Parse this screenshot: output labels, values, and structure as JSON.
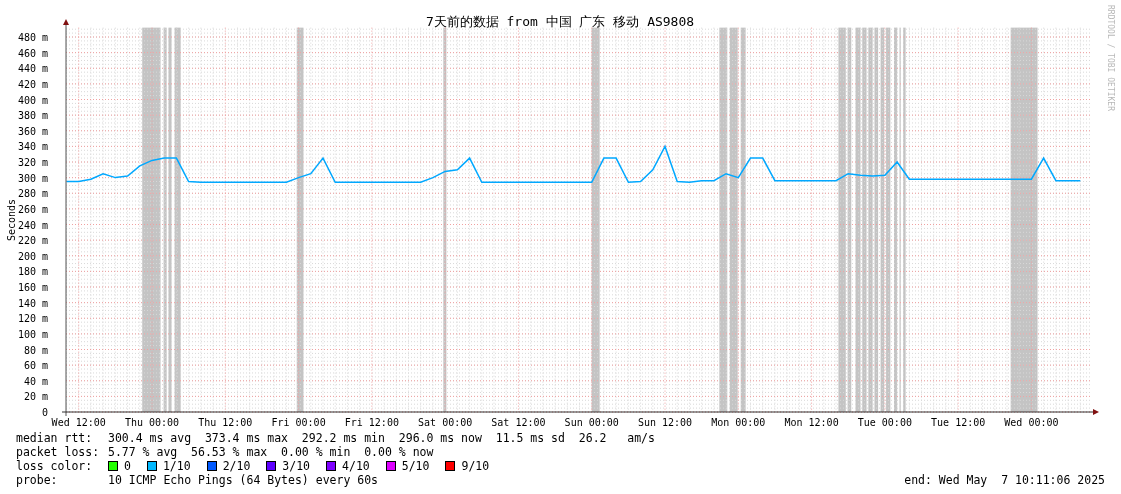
{
  "chart": {
    "credit": "RRDTOOL / TOBI OETIKER",
    "chart_data": {
      "type": "line",
      "title": "7天前的数据 from 中国 广东 移动 AS9808",
      "ylabel": "Seconds",
      "categories": [
        null,
        "Wed 12:00",
        null,
        null,
        null,
        null,
        null,
        "Thu 00:00",
        null,
        null,
        null,
        null,
        null,
        "Thu 12:00",
        null,
        null,
        null,
        null,
        null,
        "Fri 00:00",
        null,
        null,
        null,
        null,
        null,
        "Fri 12:00",
        null,
        null,
        null,
        null,
        null,
        "Sat 00:00",
        null,
        null,
        null,
        null,
        null,
        "Sat 12:00",
        null,
        null,
        null,
        null,
        null,
        "Sun 00:00",
        null,
        null,
        null,
        null,
        null,
        "Sun 12:00",
        null,
        null,
        null,
        null,
        null,
        "Mon 00:00",
        null,
        null,
        null,
        null,
        null,
        "Mon 12:00",
        null,
        null,
        null,
        null,
        null,
        "Tue 00:00",
        null,
        null,
        null,
        null,
        null,
        "Tue 12:00",
        null,
        null,
        null,
        null,
        null,
        "Wed 00:00",
        null,
        null,
        null,
        null
      ],
      "series": [
        {
          "name": "median rtt:",
          "color": "#00a8ff",
          "values": [
            295,
            295,
            298,
            305,
            300,
            302,
            315,
            322,
            325,
            325,
            295,
            294,
            294,
            294,
            294,
            294,
            294,
            294,
            294,
            300,
            305,
            325,
            294,
            294,
            294,
            294,
            294,
            294,
            294,
            294,
            300,
            308,
            310,
            325,
            294,
            294,
            294,
            294,
            294,
            294,
            294,
            294,
            294,
            294,
            325,
            325,
            294,
            295,
            310,
            340,
            295,
            294,
            296,
            296,
            305,
            300,
            325,
            325,
            296,
            296,
            296,
            296,
            296,
            296,
            305,
            303,
            302,
            303,
            320,
            298,
            298,
            298,
            298,
            298,
            298,
            298,
            298,
            298,
            298,
            298,
            325,
            296,
            296,
            296
          ]
        }
      ],
      "ylim": [
        0,
        492
      ],
      "grid": true,
      "yticks": [
        0,
        {
          "value": 20,
          "label": "20 m"
        },
        {
          "value": 40,
          "label": "40 m"
        },
        {
          "value": 60,
          "label": "60 m"
        },
        {
          "value": 80,
          "label": "80 m"
        },
        {
          "value": 100,
          "label": "100 m"
        },
        {
          "value": 120,
          "label": "120 m"
        },
        {
          "value": 140,
          "label": "140 m"
        },
        {
          "value": 160,
          "label": "160 m"
        },
        {
          "value": 180,
          "label": "180 m"
        },
        {
          "value": 200,
          "label": "200 m"
        },
        {
          "value": 220,
          "label": "220 m"
        },
        {
          "value": 240,
          "label": "240 m"
        },
        {
          "value": 260,
          "label": "260 m"
        },
        {
          "value": 280,
          "label": "280 m"
        },
        {
          "value": 300,
          "label": "300 m"
        },
        {
          "value": 320,
          "label": "320 m"
        },
        {
          "value": 340,
          "label": "340 m"
        },
        {
          "value": 360,
          "label": "360 m"
        },
        {
          "value": 380,
          "label": "380 m"
        },
        {
          "value": 400,
          "label": "400 m"
        },
        {
          "value": 420,
          "label": "420 m"
        },
        {
          "value": 440,
          "label": "440 m"
        },
        {
          "value": 460,
          "label": "460 m"
        },
        {
          "value": 480,
          "label": "480 m"
        }
      ]
    }
  },
  "stats": [
    {
      "value": "300.4 ms avg  373.4 ms max  292.2 ms min  296.0 ms now  11.5 ms sd  26.2   am/s"
    },
    {
      "label": "packet loss:",
      "value": "5.77 % avg  56.53 % max  0.00 % min  0.00 % now"
    }
  ],
  "loss_legend": {
    "label": "loss color:",
    "items": [
      {
        "label": "0",
        "color": "#22ff00"
      },
      {
        "label": "1/10",
        "color": "#00b8ff"
      },
      {
        "label": "2/10",
        "color": "#0059ff"
      },
      {
        "label": "3/10",
        "color": "#5e00ff"
      },
      {
        "label": "4/10",
        "color": "#7e00ff"
      },
      {
        "label": "5/10",
        "color": "#dd00ff"
      },
      {
        "label": "9/10",
        "color": "#ff0000"
      }
    ]
  },
  "probe": {
    "label": "probe:",
    "value": "10 ICMP Echo Pings (64 Bytes) every 60s"
  },
  "end": "end: Wed May  7 10:11:06 2025"
}
